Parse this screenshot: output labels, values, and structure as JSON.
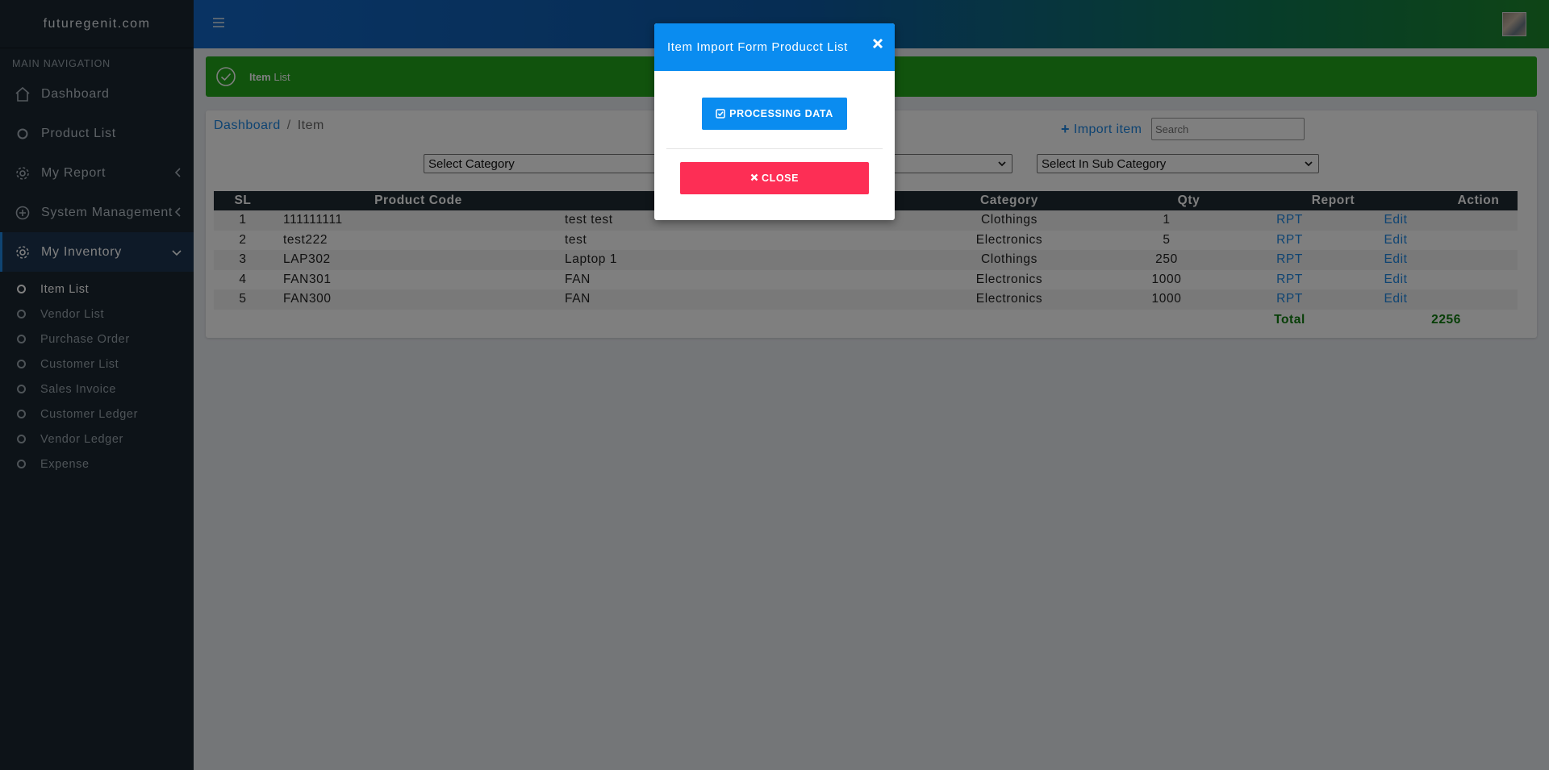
{
  "sidebar": {
    "brand": "futuregenit.com",
    "nav_header": "MAIN NAVIGATION",
    "items": [
      {
        "label": "Dashboard",
        "icon": "home-icon"
      },
      {
        "label": "Product List",
        "icon": "circle-icon"
      },
      {
        "label": "My Report",
        "icon": "gear-icon"
      },
      {
        "label": "System Management",
        "icon": "plus-circle-icon"
      },
      {
        "label": "My Inventory",
        "icon": "gear-icon"
      }
    ],
    "sub_items": [
      "Item List",
      "Vendor List",
      "Purchase Order",
      "Customer List",
      "Sales Invoice",
      "Customer Ledger",
      "Vendor Ledger",
      "Expense"
    ]
  },
  "alert": {
    "bold": "Item",
    "rest": " List"
  },
  "breadcrumb": {
    "home": "Dashboard",
    "separator": "/",
    "current": "Item"
  },
  "toolbar": {
    "import_label": "Import item",
    "search_placeholder": "Search"
  },
  "filters": {
    "category": "Select Category",
    "sub_category_hidden": "",
    "in_sub_category": "Select In Sub Category"
  },
  "table": {
    "headers": {
      "sl": "SL",
      "code": "Product Code",
      "category": "Category",
      "qty": "Qty",
      "report": "Report",
      "action": "Action"
    },
    "rows": [
      {
        "sl": "1",
        "code": "111111111",
        "name": "test test",
        "category": "Clothings",
        "qty": "1",
        "report": "RPT",
        "action": "Edit"
      },
      {
        "sl": "2",
        "code": "test222",
        "name": "test",
        "category": "Electronics",
        "qty": "5",
        "report": "RPT",
        "action": "Edit"
      },
      {
        "sl": "3",
        "code": "LAP302",
        "name": "Laptop 1",
        "category": "Clothings",
        "qty": "250",
        "report": "RPT",
        "action": "Edit"
      },
      {
        "sl": "4",
        "code": "FAN301",
        "name": "FAN",
        "category": "Electronics",
        "qty": "1000",
        "report": "RPT",
        "action": "Edit"
      },
      {
        "sl": "5",
        "code": "FAN300",
        "name": "FAN",
        "category": "Electronics",
        "qty": "1000",
        "report": "RPT",
        "action": "Edit"
      }
    ],
    "total_label": "Total",
    "total_value": "2256"
  },
  "modal": {
    "title": "Item Import Form Producct List",
    "processing_label": "PROCESSING DATA",
    "close_label": "CLOSE"
  },
  "colors": {
    "primary": "#0a8cf0",
    "danger": "#fd2e55",
    "success": "#22a61b",
    "sidebar": "#1b2630"
  }
}
